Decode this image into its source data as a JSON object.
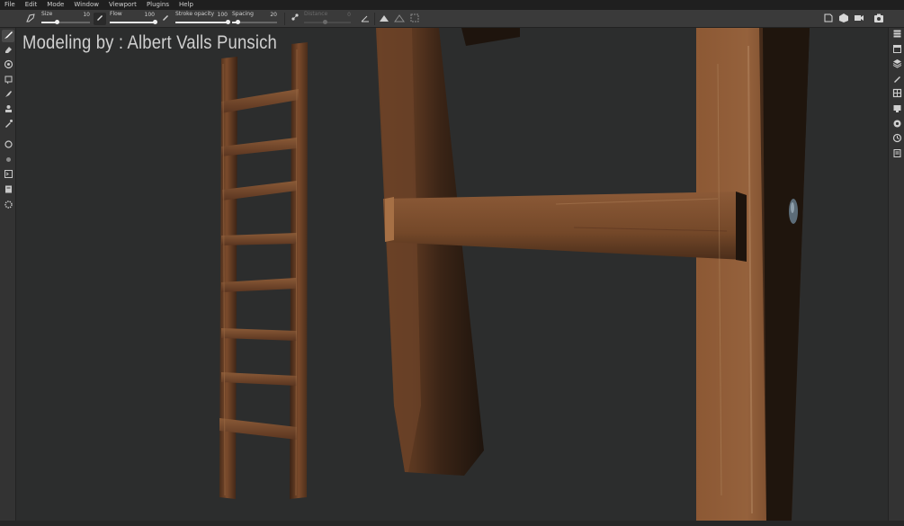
{
  "menu": [
    "File",
    "Edit",
    "Mode",
    "Window",
    "Viewport",
    "Plugins",
    "Help"
  ],
  "tool_options": {
    "size": {
      "label": "Size",
      "value": "10",
      "level": 0.32
    },
    "flow": {
      "label": "Flow",
      "value": "100",
      "level": 1.0
    },
    "stroke_opacity": {
      "label": "Stroke opacity",
      "value": "100",
      "level": 1.0
    },
    "spacing": {
      "label": "Spacing",
      "value": "20",
      "level": 0.12
    },
    "distance": {
      "label": "Distance",
      "value": "0",
      "level": 0.45,
      "disabled": true
    }
  },
  "left_tools": [
    "paint-brush-icon",
    "eraser-icon",
    "projection-icon",
    "polygon-fill-icon",
    "smudge-icon",
    "clone-icon",
    "color-picker-icon",
    "bake-icon",
    "geometry-icon",
    "python-icon",
    "script-icon",
    "settings-icon"
  ],
  "right_panels": [
    "texture-set-list-icon",
    "texture-set-settings-icon",
    "layers-icon",
    "properties-icon",
    "shelf-icon",
    "display-settings-icon",
    "viewer-settings-icon",
    "history-icon",
    "log-icon"
  ],
  "viewport": {
    "overlay_text": "Modeling by : Albert Valls Punsich",
    "background_color": "#2c2d2d",
    "wood_color": "#7a4a2c"
  }
}
